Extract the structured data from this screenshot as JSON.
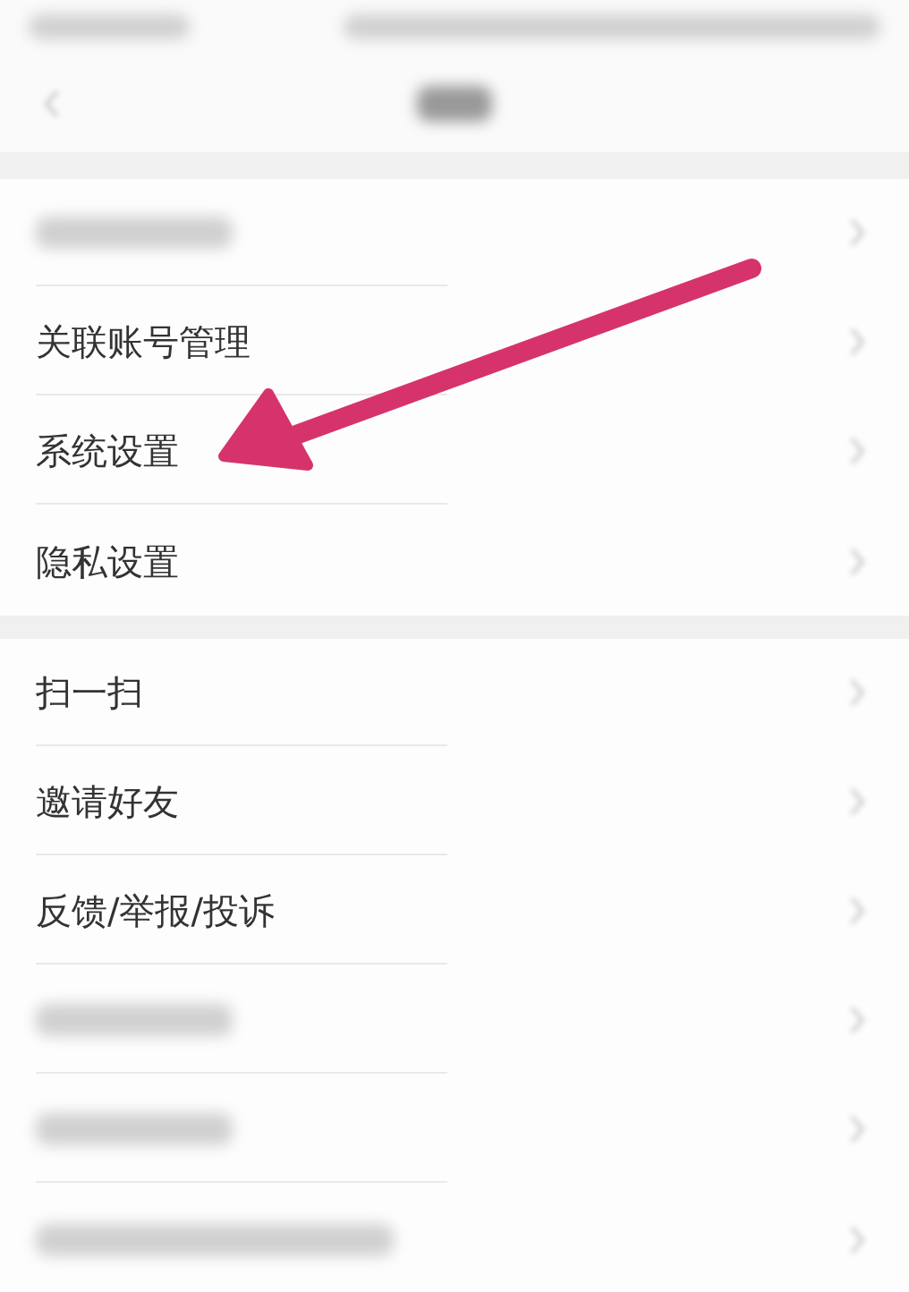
{
  "groups": [
    {
      "items": [
        {
          "kind": "blurred"
        },
        {
          "kind": "text",
          "label": "关联账号管理"
        },
        {
          "kind": "text",
          "label": "系统设置"
        },
        {
          "kind": "text",
          "label": "隐私设置"
        }
      ]
    },
    {
      "items": [
        {
          "kind": "text",
          "label": "扫一扫"
        },
        {
          "kind": "text",
          "label": "邀请好友"
        },
        {
          "kind": "text",
          "label": "反馈/举报/投诉"
        },
        {
          "kind": "blurred"
        },
        {
          "kind": "blurred"
        },
        {
          "kind": "blurred"
        }
      ]
    }
  ]
}
